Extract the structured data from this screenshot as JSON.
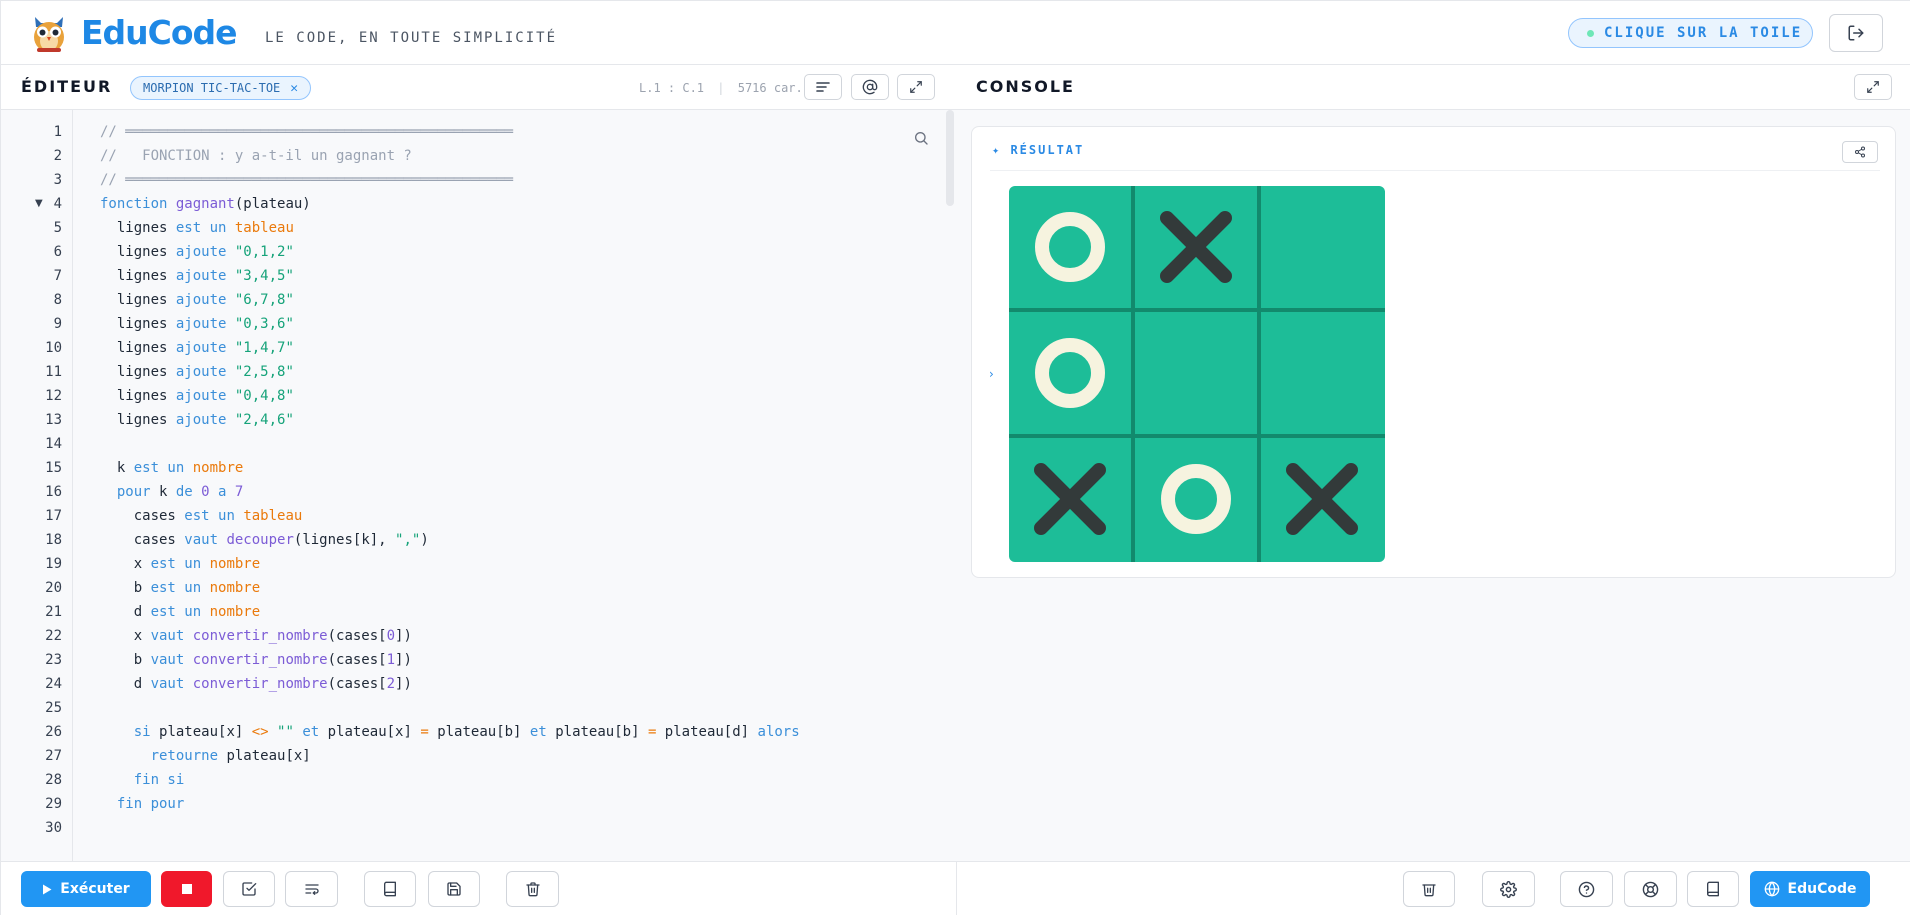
{
  "header": {
    "brand": "EduCode",
    "tagline": "LE CODE, EN TOUTE SIMPLICITÉ",
    "hint": "CLIQUE SUR LA TOILE",
    "logo_icon": "owl-logo-icon",
    "logout_icon": "logout-icon"
  },
  "editor": {
    "title": "ÉDITEUR",
    "file_tab": "MORPION TIC-TAC-TOE",
    "cursor": "L.1 : C.1",
    "separator": "|",
    "chars": "5716 car.",
    "tools": [
      "format-icon",
      "at-icon",
      "expand-icon"
    ],
    "line_numbers": [
      "1",
      "2",
      "3",
      "4",
      "5",
      "6",
      "7",
      "8",
      "9",
      "10",
      "11",
      "12",
      "13",
      "14",
      "15",
      "16",
      "17",
      "18",
      "19",
      "20",
      "21",
      "22",
      "23",
      "24",
      "25",
      "26",
      "27",
      "28",
      "29",
      "30"
    ],
    "code": [
      [
        [
          "com",
          "// ══════════════════════════════════════════════"
        ]
      ],
      [
        [
          "com",
          "//   FONCTION : y a-t-il un gagnant ?"
        ]
      ],
      [
        [
          "com",
          "// ══════════════════════════════════════════════"
        ]
      ],
      [
        [
          "kw",
          "fonction "
        ],
        [
          "fn",
          "gagnant"
        ],
        [
          "pl",
          "(plateau)"
        ]
      ],
      [
        [
          "pl",
          "  lignes "
        ],
        [
          "kw",
          "est un "
        ],
        [
          "ty",
          "tableau"
        ]
      ],
      [
        [
          "pl",
          "  lignes "
        ],
        [
          "kw",
          "ajoute "
        ],
        [
          "str",
          "\"0,1,2\""
        ]
      ],
      [
        [
          "pl",
          "  lignes "
        ],
        [
          "kw",
          "ajoute "
        ],
        [
          "str",
          "\"3,4,5\""
        ]
      ],
      [
        [
          "pl",
          "  lignes "
        ],
        [
          "kw",
          "ajoute "
        ],
        [
          "str",
          "\"6,7,8\""
        ]
      ],
      [
        [
          "pl",
          "  lignes "
        ],
        [
          "kw",
          "ajoute "
        ],
        [
          "str",
          "\"0,3,6\""
        ]
      ],
      [
        [
          "pl",
          "  lignes "
        ],
        [
          "kw",
          "ajoute "
        ],
        [
          "str",
          "\"1,4,7\""
        ]
      ],
      [
        [
          "pl",
          "  lignes "
        ],
        [
          "kw",
          "ajoute "
        ],
        [
          "str",
          "\"2,5,8\""
        ]
      ],
      [
        [
          "pl",
          "  lignes "
        ],
        [
          "kw",
          "ajoute "
        ],
        [
          "str",
          "\"0,4,8\""
        ]
      ],
      [
        [
          "pl",
          "  lignes "
        ],
        [
          "kw",
          "ajoute "
        ],
        [
          "str",
          "\"2,4,6\""
        ]
      ],
      [
        [
          "pl",
          ""
        ]
      ],
      [
        [
          "pl",
          "  k "
        ],
        [
          "kw",
          "est un "
        ],
        [
          "ty",
          "nombre"
        ]
      ],
      [
        [
          "kw",
          "  pour "
        ],
        [
          "pl",
          "k "
        ],
        [
          "kw",
          "de "
        ],
        [
          "num",
          "0 "
        ],
        [
          "kw",
          "a "
        ],
        [
          "num",
          "7"
        ]
      ],
      [
        [
          "pl",
          "    cases "
        ],
        [
          "kw",
          "est un "
        ],
        [
          "ty",
          "tableau"
        ]
      ],
      [
        [
          "pl",
          "    cases "
        ],
        [
          "kw",
          "vaut "
        ],
        [
          "fn",
          "decouper"
        ],
        [
          "pl",
          "(lignes[k], "
        ],
        [
          "str",
          "\",\""
        ],
        [
          "pl",
          ")"
        ]
      ],
      [
        [
          "pl",
          "    x "
        ],
        [
          "kw",
          "est un "
        ],
        [
          "ty",
          "nombre"
        ]
      ],
      [
        [
          "pl",
          "    b "
        ],
        [
          "kw",
          "est un "
        ],
        [
          "ty",
          "nombre"
        ]
      ],
      [
        [
          "pl",
          "    d "
        ],
        [
          "kw",
          "est un "
        ],
        [
          "ty",
          "nombre"
        ]
      ],
      [
        [
          "pl",
          "    x "
        ],
        [
          "kw",
          "vaut "
        ],
        [
          "fn",
          "convertir_nombre"
        ],
        [
          "pl",
          "(cases["
        ],
        [
          "num",
          "0"
        ],
        [
          "pl",
          "])"
        ]
      ],
      [
        [
          "pl",
          "    b "
        ],
        [
          "kw",
          "vaut "
        ],
        [
          "fn",
          "convertir_nombre"
        ],
        [
          "pl",
          "(cases["
        ],
        [
          "num",
          "1"
        ],
        [
          "pl",
          "])"
        ]
      ],
      [
        [
          "pl",
          "    d "
        ],
        [
          "kw",
          "vaut "
        ],
        [
          "fn",
          "convertir_nombre"
        ],
        [
          "pl",
          "(cases["
        ],
        [
          "num",
          "2"
        ],
        [
          "pl",
          "])"
        ]
      ],
      [
        [
          "pl",
          ""
        ]
      ],
      [
        [
          "kw",
          "    si "
        ],
        [
          "pl",
          "plateau[x] "
        ],
        [
          "op",
          "<> "
        ],
        [
          "str",
          "\"\" "
        ],
        [
          "kw",
          "et "
        ],
        [
          "pl",
          "plateau[x] "
        ],
        [
          "op",
          "= "
        ],
        [
          "pl",
          "plateau[b] "
        ],
        [
          "kw",
          "et "
        ],
        [
          "pl",
          "plateau[b] "
        ],
        [
          "op",
          "= "
        ],
        [
          "pl",
          "plateau[d] "
        ],
        [
          "kw",
          "alors"
        ]
      ],
      [
        [
          "kw",
          "      retourne "
        ],
        [
          "pl",
          "plateau[x]"
        ]
      ],
      [
        [
          "kw",
          "    fin si"
        ]
      ],
      [
        [
          "kw",
          "  fin pour"
        ]
      ],
      [
        [
          "pl",
          ""
        ]
      ]
    ]
  },
  "console": {
    "title": "CONSOLE",
    "result_label": "✦ RÉSULTAT",
    "chevron": "›",
    "board": [
      "O",
      "X",
      "",
      "O",
      "",
      "",
      "X",
      "O",
      "X"
    ]
  },
  "toolbar": {
    "run_label": "Exécuter",
    "educode_label": "EduCode"
  },
  "colors": {
    "accent": "#2196f3",
    "stop": "#f0182b",
    "board": "#1dbd98",
    "board_lines": "#128a6d",
    "mark_x": "#333a3a",
    "mark_o": "#f6f3df"
  }
}
